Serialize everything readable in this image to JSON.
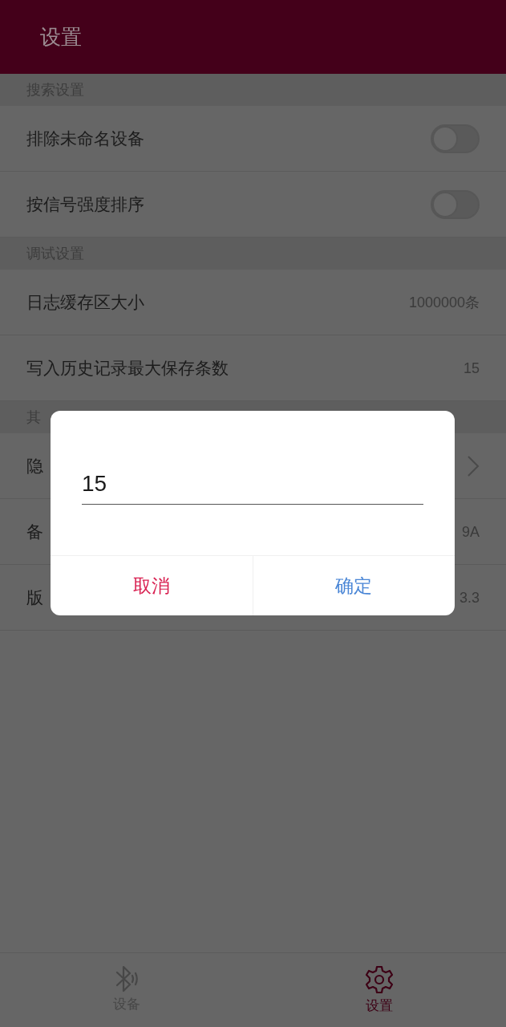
{
  "app_bar": {
    "title": "设置"
  },
  "sections": [
    {
      "title": "搜索设置",
      "rows": [
        {
          "kind": "toggle",
          "label": "排除未命名设备",
          "on": false
        },
        {
          "kind": "toggle",
          "label": "按信号强度排序",
          "on": false
        }
      ]
    },
    {
      "title": "调试设置",
      "rows": [
        {
          "kind": "value",
          "label": "日志缓存区大小",
          "value": "1000000条"
        },
        {
          "kind": "value",
          "label": "写入历史记录最大保存条数",
          "value": "15"
        }
      ]
    },
    {
      "title": "其",
      "rows": [
        {
          "kind": "link",
          "label": "隐"
        },
        {
          "kind": "value",
          "label": "备",
          "value": "9A"
        },
        {
          "kind": "value",
          "label": "版",
          "value": "3.3"
        }
      ]
    }
  ],
  "dialog": {
    "input": {
      "value": "15"
    },
    "buttons": [
      {
        "kind": "cancel",
        "label": "取消"
      },
      {
        "kind": "confirm",
        "label": "确定"
      }
    ]
  },
  "bottom_nav": {
    "tabs": [
      {
        "label": "设备",
        "selected": false
      },
      {
        "label": "设置",
        "selected": true
      }
    ]
  }
}
